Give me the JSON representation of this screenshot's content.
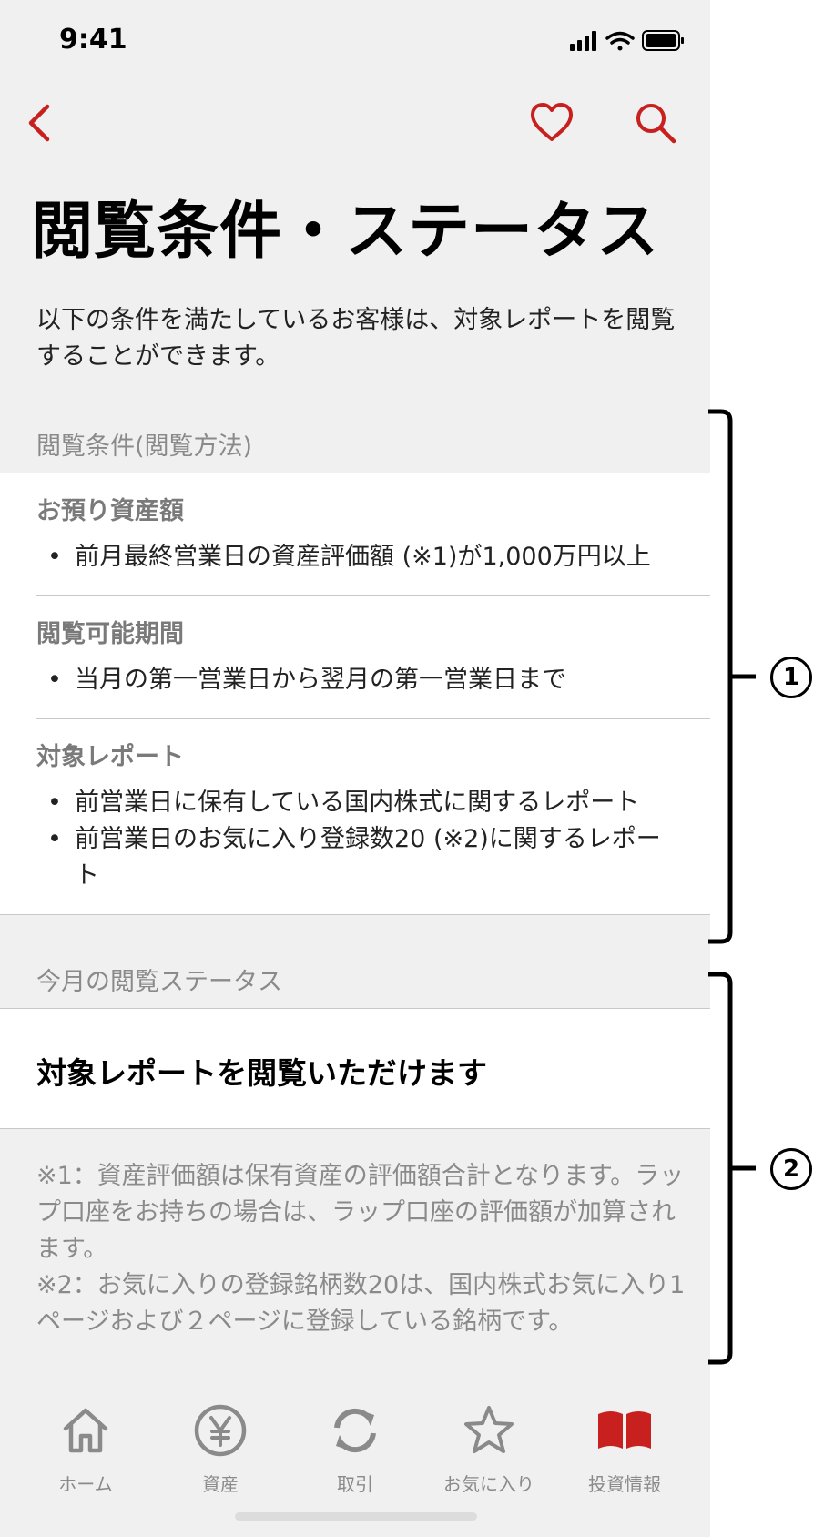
{
  "status_bar": {
    "time": "9:41"
  },
  "nav": {
    "back_icon": "chevron-left-icon",
    "favorite_icon": "heart-icon",
    "search_icon": "search-icon"
  },
  "page": {
    "title": "閲覧条件・ステータス",
    "intro": "以下の条件を満たしているお客様は、対象レポートを閲覧することができます。"
  },
  "conditions": {
    "header": "閲覧条件(閲覧方法)",
    "blocks": [
      {
        "title": "お預り資産額",
        "items": [
          "前月最終営業日の資産評価額 (※1)が1,000万円以上"
        ]
      },
      {
        "title": "閲覧可能期間",
        "items": [
          "当月の第一営業日から翌月の第一営業日まで"
        ]
      },
      {
        "title": "対象レポート",
        "items": [
          "前営業日に保有している国内株式に関するレポート",
          "前営業日のお気に入り登録数20 (※2)に関するレポート"
        ]
      }
    ]
  },
  "status": {
    "header": "今月の閲覧ステータス",
    "message": "対象レポートを閲覧いただけます"
  },
  "notes": {
    "note1": "※1：資産評価額は保有資産の評価額合計となります。ラップ口座をお持ちの場合は、ラップ口座の評価額が加算されます。",
    "note2": "※2：お気に入りの登録銘柄数20は、国内株式お気に入り1ページおよび２ページに登録している銘柄です。"
  },
  "tabs": [
    {
      "label": "ホーム",
      "icon": "home-icon"
    },
    {
      "label": "資産",
      "icon": "yen-icon"
    },
    {
      "label": "取引",
      "icon": "refresh-icon"
    },
    {
      "label": "お気に入り",
      "icon": "star-icon"
    },
    {
      "label": "投資情報",
      "icon": "book-icon",
      "active": true
    }
  ],
  "annotations": {
    "callout1": "1",
    "callout2": "2"
  },
  "colors": {
    "accent": "#c8201e",
    "background": "#f0f0f0",
    "text_muted": "#8a8a8a"
  }
}
